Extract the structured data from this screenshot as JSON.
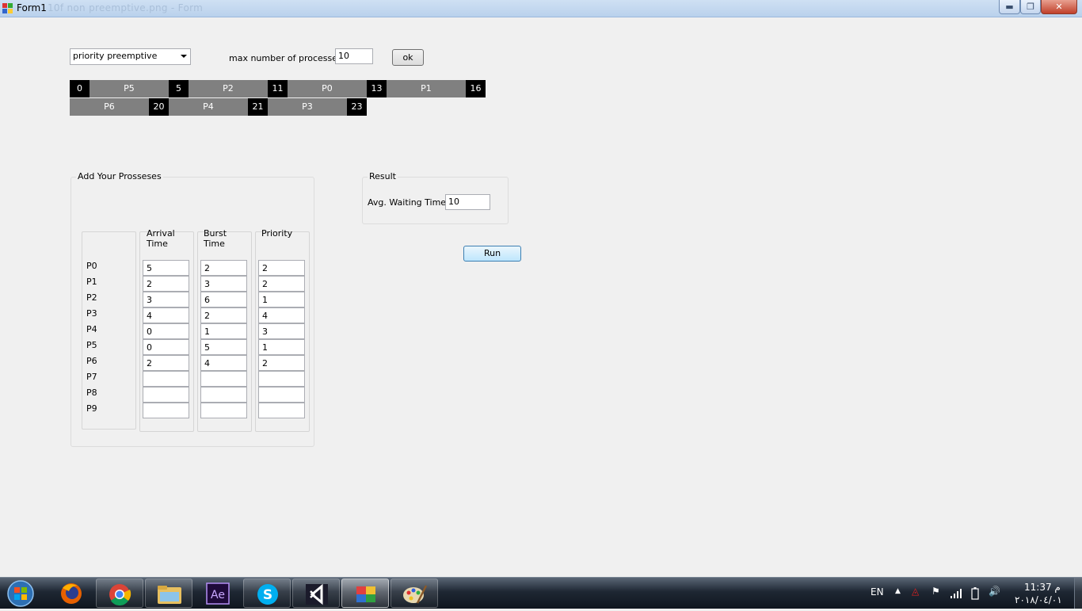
{
  "window": {
    "title": "Form1",
    "ghost_title": "10f non preemptive.png - Form"
  },
  "controls": {
    "algorithm": "priority preemptive",
    "max_label": "max number of processes",
    "max_value": "10",
    "ok_label": "ok"
  },
  "gantt": {
    "row1": [
      {
        "kind": "time",
        "text": "0"
      },
      {
        "kind": "proc",
        "text": "P5"
      },
      {
        "kind": "time",
        "text": "5"
      },
      {
        "kind": "proc",
        "text": "P2"
      },
      {
        "kind": "time",
        "text": "11"
      },
      {
        "kind": "proc",
        "text": "P0"
      },
      {
        "kind": "time",
        "text": "13"
      },
      {
        "kind": "proc",
        "text": "P1"
      },
      {
        "kind": "time",
        "text": "16"
      }
    ],
    "row2": [
      {
        "kind": "proc",
        "text": "P6"
      },
      {
        "kind": "time",
        "text": "20"
      },
      {
        "kind": "proc",
        "text": "P4"
      },
      {
        "kind": "time",
        "text": "21"
      },
      {
        "kind": "proc",
        "text": "P3"
      },
      {
        "kind": "time",
        "text": "23"
      }
    ]
  },
  "processes": {
    "group_title": "Add Your Prosseses",
    "headers": {
      "arrival": "Arrival\nTime",
      "burst": "Burst\nTime",
      "priority": "Priority"
    },
    "rows": [
      {
        "name": "P0",
        "arrival": "5",
        "burst": "2",
        "priority": "2"
      },
      {
        "name": "P1",
        "arrival": "2",
        "burst": "3",
        "priority": "2"
      },
      {
        "name": "P2",
        "arrival": "3",
        "burst": "6",
        "priority": "1"
      },
      {
        "name": "P3",
        "arrival": "4",
        "burst": "2",
        "priority": "4"
      },
      {
        "name": "P4",
        "arrival": "0",
        "burst": "1",
        "priority": "3"
      },
      {
        "name": "P5",
        "arrival": "0",
        "burst": "5",
        "priority": "1"
      },
      {
        "name": "P6",
        "arrival": "2",
        "burst": "4",
        "priority": "2"
      },
      {
        "name": "P7",
        "arrival": "",
        "burst": "",
        "priority": ""
      },
      {
        "name": "P8",
        "arrival": "",
        "burst": "",
        "priority": ""
      },
      {
        "name": "P9",
        "arrival": "",
        "burst": "",
        "priority": ""
      }
    ]
  },
  "result": {
    "group_title": "Result",
    "avg_label": "Avg. Waiting Time",
    "avg_value": "10"
  },
  "run_label": "Run",
  "taskbar": {
    "apps": [
      "firefox-icon",
      "chrome-icon",
      "file-explorer-icon",
      "after-effects-icon",
      "skype-icon",
      "visual-studio-icon",
      "winforms-app-icon",
      "paint-icon"
    ],
    "lang": "EN",
    "time": "11:37 م",
    "date": "٢٠١٨/٠٤/٠١"
  }
}
